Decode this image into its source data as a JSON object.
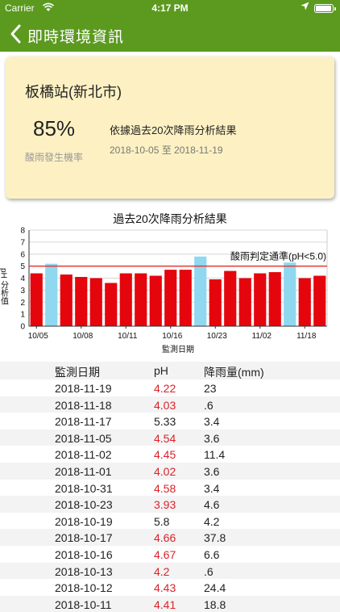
{
  "status": {
    "carrier": "Carrier",
    "time": "4:17 PM"
  },
  "nav": {
    "title": "即時環境資訊"
  },
  "card": {
    "station": "板橋站(新北市)",
    "probability": "85%",
    "probability_label": "酸雨發生機率",
    "description": "依據過去20次降雨分析結果",
    "date_range": "2018-10-05 至 2018-11-19"
  },
  "chart_data": {
    "type": "bar",
    "title": "過去20次降雨分析結果",
    "xlabel": "監測日期",
    "ylabel": "pH 分析值",
    "ylim": [
      0,
      8
    ],
    "yticks": [
      0,
      1,
      2,
      3,
      4,
      5,
      6,
      7,
      8
    ],
    "threshold": {
      "value": 5.0,
      "label": "酸雨判定通準(pH<5.0)",
      "color": "#e53935"
    },
    "x_tick_labels": [
      "10/05",
      "10/08",
      "10/11",
      "10/16",
      "10/23",
      "11/02",
      "11/18"
    ],
    "x_tick_positions": [
      0,
      3,
      6,
      9,
      12,
      15,
      18
    ],
    "values": [
      4.4,
      5.2,
      4.3,
      4.1,
      4.0,
      3.6,
      4.4,
      4.4,
      4.2,
      4.7,
      4.7,
      5.8,
      3.9,
      4.6,
      4.0,
      4.4,
      4.5,
      5.3,
      4.0,
      4.2
    ],
    "acid_color": "#e4060c",
    "normal_color": "#8fd8f0"
  },
  "table": {
    "headers": {
      "date": "監測日期",
      "ph": "pH",
      "rain": "降雨量(mm)"
    },
    "rows": [
      {
        "date": "2018-11-19",
        "ph": "4.22",
        "rain": "23"
      },
      {
        "date": "2018-11-18",
        "ph": "4.03",
        "rain": ".6"
      },
      {
        "date": "2018-11-17",
        "ph": "5.33",
        "rain": "3.4"
      },
      {
        "date": "2018-11-05",
        "ph": "4.54",
        "rain": "3.6"
      },
      {
        "date": "2018-11-02",
        "ph": "4.45",
        "rain": "11.4"
      },
      {
        "date": "2018-11-01",
        "ph": "4.02",
        "rain": "3.6"
      },
      {
        "date": "2018-10-31",
        "ph": "4.58",
        "rain": "3.4"
      },
      {
        "date": "2018-10-23",
        "ph": "3.93",
        "rain": "4.6"
      },
      {
        "date": "2018-10-19",
        "ph": "5.8",
        "rain": "4.2"
      },
      {
        "date": "2018-10-17",
        "ph": "4.66",
        "rain": "37.8"
      },
      {
        "date": "2018-10-16",
        "ph": "4.67",
        "rain": "6.6"
      },
      {
        "date": "2018-10-13",
        "ph": "4.2",
        "rain": ".6"
      },
      {
        "date": "2018-10-12",
        "ph": "4.43",
        "rain": "24.4"
      },
      {
        "date": "2018-10-11",
        "ph": "4.41",
        "rain": "18.8"
      }
    ]
  }
}
